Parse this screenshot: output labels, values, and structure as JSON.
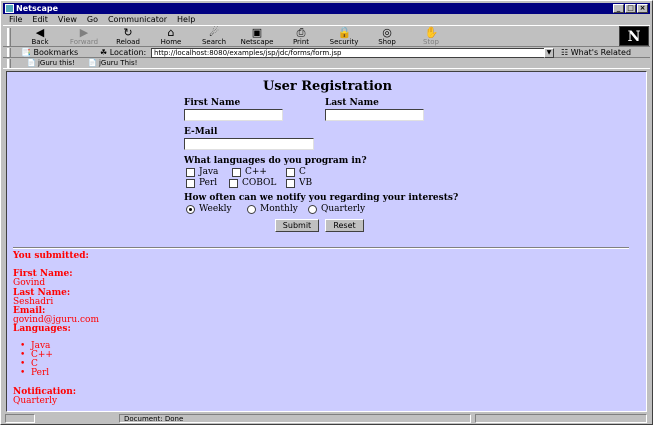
{
  "window": {
    "title": "Netscape"
  },
  "menu": [
    "File",
    "Edit",
    "View",
    "Go",
    "Communicator",
    "Help"
  ],
  "toolbar": [
    {
      "label": "Back",
      "icon": "back-arrow-icon",
      "glyph": "◀",
      "disabled": false
    },
    {
      "label": "Forward",
      "icon": "forward-arrow-icon",
      "glyph": "▶",
      "disabled": true
    },
    {
      "label": "Reload",
      "icon": "reload-icon",
      "glyph": "↻",
      "disabled": false
    },
    {
      "label": "Home",
      "icon": "home-icon",
      "glyph": "⌂",
      "disabled": false
    },
    {
      "label": "Search",
      "icon": "search-icon",
      "glyph": "☄",
      "disabled": false
    },
    {
      "label": "Netscape",
      "icon": "netscape-icon",
      "glyph": "▣",
      "disabled": false
    },
    {
      "label": "Print",
      "icon": "print-icon",
      "glyph": "⎙",
      "disabled": false
    },
    {
      "label": "Security",
      "icon": "lock-icon",
      "glyph": "🔒",
      "disabled": false
    },
    {
      "label": "Shop",
      "icon": "shop-icon",
      "glyph": "◎",
      "disabled": false
    },
    {
      "label": "Stop",
      "icon": "stop-icon",
      "glyph": "✋",
      "disabled": true
    }
  ],
  "location": {
    "bookmarks_label": "Bookmarks",
    "location_label": "Location:",
    "url": "http://localhost:8080/examples/jsp/jdc/forms/form.jsp",
    "related_label": "What's Related"
  },
  "personal": [
    "jGuru this!",
    "jGuru This!"
  ],
  "form": {
    "heading": "User Registration",
    "first_name_label": "First Name",
    "last_name_label": "Last Name",
    "email_label": "E-Mail",
    "first_name_value": "",
    "last_name_value": "",
    "email_value": "",
    "languages_question": "What languages do you program in?",
    "languages": [
      "Java",
      "C++",
      "C",
      "Perl",
      "COBOL",
      "VB"
    ],
    "notify_question": "How often can we notify you regarding your interests?",
    "notify_options": [
      "Weekly",
      "Monthly",
      "Quarterly"
    ],
    "notify_selected": "Weekly",
    "submit_label": "Submit",
    "reset_label": "Reset"
  },
  "result": {
    "heading": "You submitted:",
    "first_name_label": "First Name:",
    "first_name": "Govind",
    "last_name_label": "Last Name:",
    "last_name": "Seshadri",
    "email_label": "Email:",
    "email": "govind@jguru.com",
    "languages_label": "Languages:",
    "languages": [
      "Java",
      "C++",
      "C",
      "Perl"
    ],
    "notification_label": "Notification:",
    "notification": "Quarterly"
  },
  "status": {
    "text": "Document: Done"
  },
  "colors": {
    "content_bg": "#ccccff",
    "result_text": "#ff0000",
    "titlebar": "#000080"
  }
}
